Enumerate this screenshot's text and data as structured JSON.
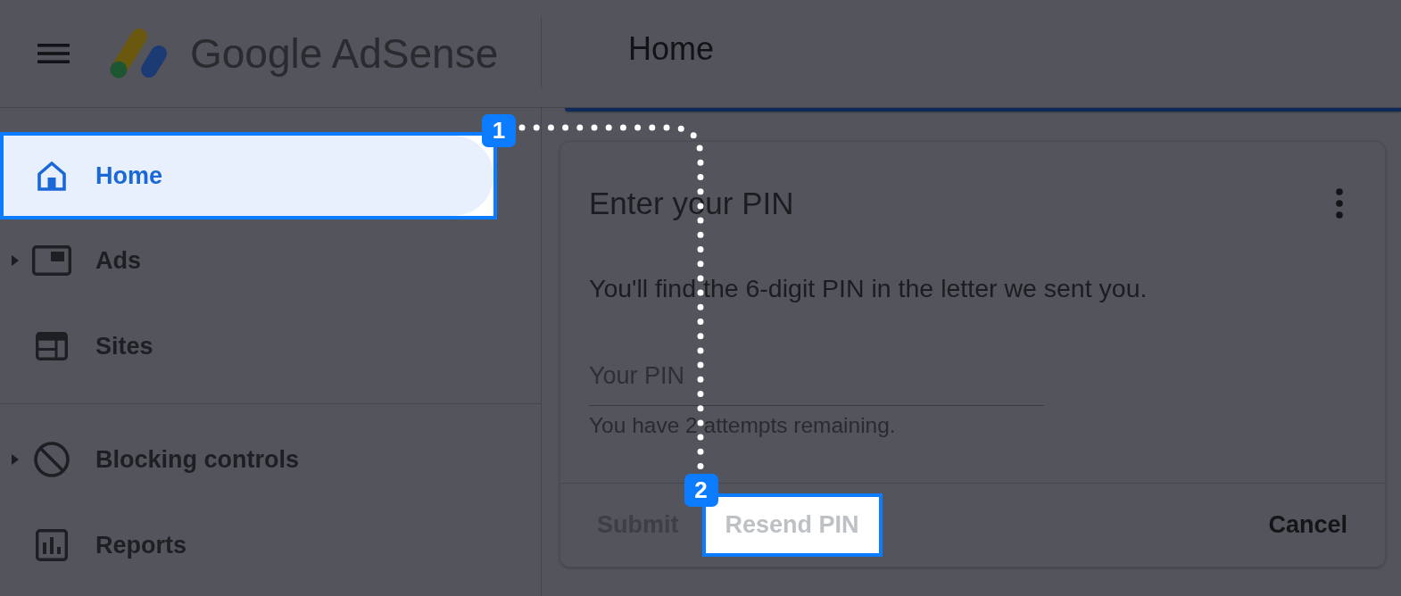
{
  "header": {
    "product_name": "Google AdSense",
    "page_title": "Home"
  },
  "sidebar": {
    "sections": [
      {
        "items": [
          {
            "label": "Home",
            "kind": "page",
            "selected": true,
            "highlighted": true,
            "marker": "1"
          },
          {
            "label": "Ads",
            "kind": "group",
            "expanded": false,
            "selected": false,
            "highlighted": false
          },
          {
            "label": "Sites",
            "kind": "page",
            "selected": false,
            "highlighted": false
          }
        ]
      },
      {
        "items": [
          {
            "label": "Blocking controls",
            "kind": "group",
            "expanded": false,
            "selected": false,
            "highlighted": false
          },
          {
            "label": "Reports",
            "kind": "page",
            "selected": false,
            "highlighted": false
          }
        ]
      }
    ]
  },
  "pin_card": {
    "title": "Enter your PIN",
    "description": "You'll find the 6-digit PIN in the letter we sent you.",
    "pin_field": {
      "placeholder": "Your PIN",
      "helper": "You have 2 attempts remaining."
    },
    "buttons": [
      {
        "label": "Submit",
        "disabled": true,
        "highlighted": false
      },
      {
        "label": "Resend PIN",
        "disabled": true,
        "highlighted": true,
        "marker": "2"
      },
      {
        "label": "Cancel",
        "disabled": false,
        "highlighted": false
      }
    ]
  }
}
